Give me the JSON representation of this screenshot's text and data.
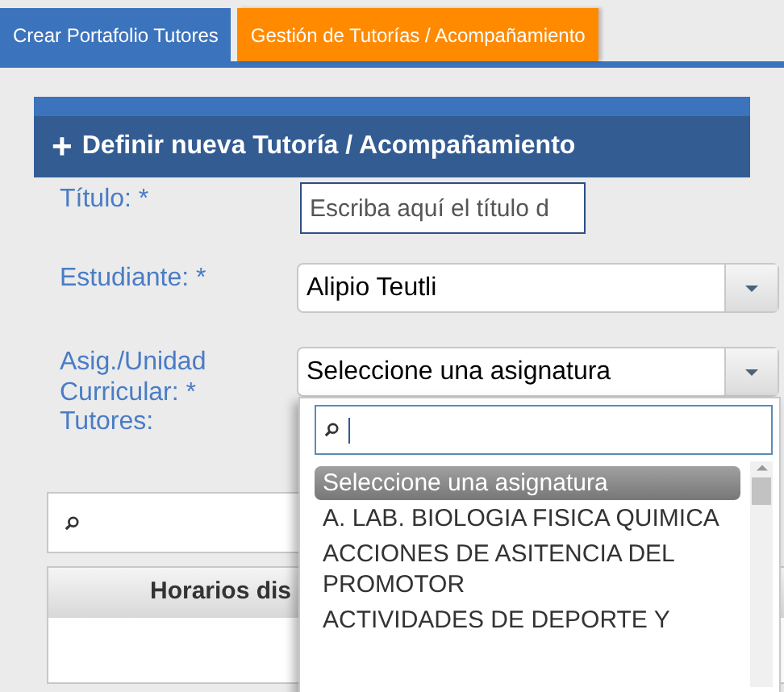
{
  "tabs": [
    {
      "label": "Crear Portafolio Tutores",
      "selected": true
    },
    {
      "label": "Gestión de Tutorías / Acompañamiento",
      "selected": false
    }
  ],
  "panel": {
    "icon": "+",
    "title": "Definir nueva Tutoría / Acompañamiento"
  },
  "form": {
    "title": {
      "label": "Título: *",
      "placeholder": "Escriba aquí el título d"
    },
    "student": {
      "label": "Estudiante: *",
      "value": "Alipio Teutli"
    },
    "subject": {
      "label": "Asig./Unidad Curricular: *",
      "value": "Seleccione una asignatura",
      "expanded": true
    },
    "tutors": {
      "label": "Tutores:"
    }
  },
  "dropdown": {
    "items": [
      {
        "label": "Seleccione una asignatura",
        "selected": true
      },
      {
        "label": "A. LAB. BIOLOGIA FISICA QUIMICA",
        "selected": false
      },
      {
        "label": "ACCIONES DE ASITENCIA DEL PROMOTOR",
        "selected": false
      },
      {
        "label": "ACTIVIDADES DE DEPORTE Y",
        "selected": false
      }
    ]
  },
  "schedule": {
    "header": "Horarios dis"
  }
}
